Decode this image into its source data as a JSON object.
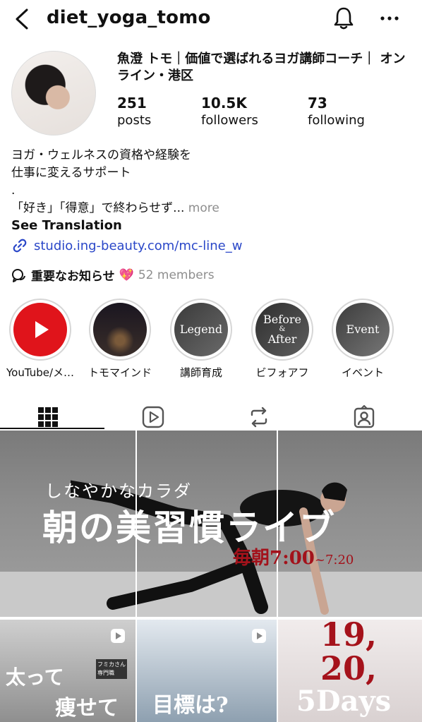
{
  "header": {
    "username": "diet_yoga_tomo"
  },
  "profile": {
    "display_name": "魚澄 トモ｜価値で選ばれるヨガ講師コーチ｜ オンライン・港区",
    "stats": [
      {
        "number": "251",
        "label": "posts"
      },
      {
        "number": "10.5K",
        "label": "followers"
      },
      {
        "number": "73",
        "label": "following"
      }
    ],
    "bio_lines": [
      "ヨガ・ウェルネスの資格や経験を",
      "仕事に変えるサポート",
      ".",
      "「好き」「得意」で終わらせず..."
    ],
    "more_label": "more",
    "see_translation": "See Translation",
    "link": "studio.ing-beauty.com/mc-line_w",
    "channel": {
      "name": "重要なお知らせ",
      "emoji": "💖",
      "members": "52 members"
    }
  },
  "highlights": [
    {
      "label": "YouTube/メ…",
      "cover_text": ""
    },
    {
      "label": "トモマインド",
      "cover_text": ""
    },
    {
      "label": "講師育成",
      "cover_text": "Legend"
    },
    {
      "label": "ビフォアフ",
      "cover_text": "Before & After"
    },
    {
      "label": "イベント",
      "cover_text": "Event"
    }
  ],
  "highlight_cover_lines": {
    "before": "Before",
    "amp": "&",
    "after": "After"
  },
  "tabs": [
    "grid",
    "reels",
    "reposts",
    "tagged"
  ],
  "posts": {
    "main": {
      "subtitle": "しなやかなカラダ",
      "title": "朝の美習慣ライブ",
      "time_main": "毎朝7:00",
      "time_end": "~7:20"
    },
    "tile1": {
      "line1": "太って",
      "line2": "痩せて",
      "badge": "フミカさん 専門職"
    },
    "tile2": {
      "text": "目標は?"
    },
    "tile3": {
      "line1": "19,",
      "line2": "20,",
      "line3": "5Days"
    }
  },
  "colors": {
    "link": "#2a47c8",
    "youtube_red": "#e0141b",
    "accent_red": "#a3121b",
    "muted": "#8e8e8e"
  }
}
